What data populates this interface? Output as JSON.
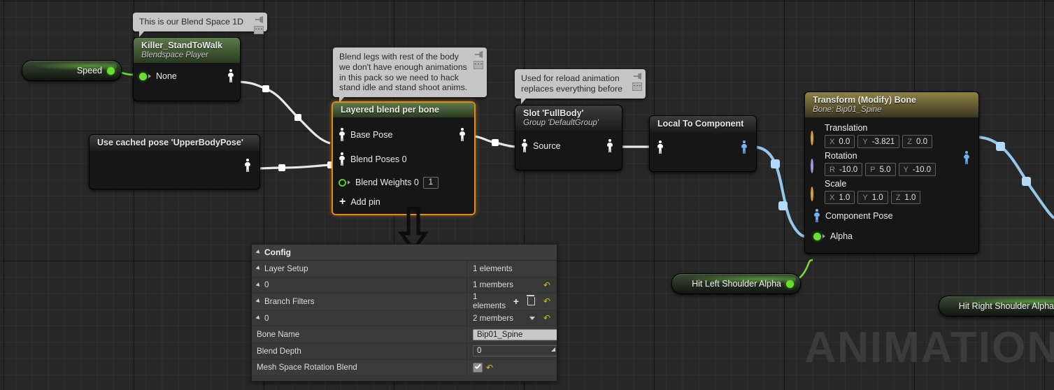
{
  "graph": {
    "watermark": "ANIMATION"
  },
  "comments": [
    {
      "text": "This is our Blend Space 1D",
      "pin_icon": "pin-icon",
      "resize_icon": "comment-bubble-icon"
    },
    {
      "text": "Blend legs with rest of the body we don't have enough animations in this pack so we need to hack stand idle and stand shoot anims.",
      "pin_icon": "pin-icon",
      "resize_icon": "comment-bubble-icon"
    },
    {
      "text": "Used for reload animation replaces everything before",
      "pin_icon": "pin-icon",
      "resize_icon": "comment-bubble-icon"
    }
  ],
  "variables": {
    "speed": "Speed",
    "hit_left_shoulder_alpha": "Hit Left Shoulder Alpha",
    "hit_right_shoulder_alpha": "Hit Right Shoulder Alpha"
  },
  "nodes": {
    "blendspace": {
      "title": "Killer_StandToWalk",
      "subtitle": "Blendspace Player",
      "input_pin": "None"
    },
    "cached_pose": {
      "title": "Use cached pose 'UpperBodyPose'"
    },
    "layered_blend": {
      "title": "Layered blend per bone",
      "pins": [
        "Base Pose",
        "Blend Poses 0",
        "Blend Weights 0"
      ],
      "blend_weight_value": "1",
      "add_pin": "Add pin"
    },
    "slot": {
      "title": "Slot 'FullBody'",
      "subtitle": "Group 'DefaultGroup'",
      "input_pin": "Source"
    },
    "local_to_component": {
      "title": "Local To Component"
    },
    "transform_bone": {
      "title": "Transform (Modify) Bone",
      "subtitle": "Bone: Bip01_Spine",
      "translation": {
        "label": "Translation",
        "x_axis": "X",
        "x": "0.0",
        "y_axis": "Y",
        "y": "-3.821",
        "z_axis": "Z",
        "z": "0.0"
      },
      "rotation": {
        "label": "Rotation",
        "r_axis": "R",
        "r": "-10.0",
        "p_axis": "P",
        "p": "5.0",
        "y_axis": "Y",
        "y": "-10.0"
      },
      "scale": {
        "label": "Scale",
        "x_axis": "X",
        "x": "1.0",
        "y_axis": "Y",
        "y": "1.0",
        "z_axis": "Z",
        "z": "1.0"
      },
      "component_pose": "Component Pose",
      "alpha": "Alpha"
    }
  },
  "config": {
    "header": "Config",
    "rows": [
      {
        "name": "Layer Setup",
        "value": "1 elements",
        "indent": 1,
        "expander": "expanded",
        "reset": false,
        "add": false,
        "del": false,
        "field": "none"
      },
      {
        "name": "0",
        "value": "1 members",
        "indent": 2,
        "expander": "expanded",
        "reset": true,
        "add": false,
        "del": false,
        "field": "none"
      },
      {
        "name": "Branch Filters",
        "value": "1 elements",
        "indent": 3,
        "expander": "expanded",
        "reset": true,
        "add": true,
        "del": true,
        "field": "none"
      },
      {
        "name": "0",
        "value": "2 members",
        "indent": 4,
        "expander": "expanded",
        "reset": true,
        "add": false,
        "del": false,
        "field": "dropdown"
      },
      {
        "name": "Bone Name",
        "value": "Bip01_Spine",
        "indent": 5,
        "expander": "none",
        "reset": true,
        "add": false,
        "del": false,
        "field": "text"
      },
      {
        "name": "Blend Depth",
        "value": "0",
        "indent": 5,
        "expander": "none",
        "reset": true,
        "add": false,
        "del": false,
        "field": "number"
      },
      {
        "name": "Mesh Space Rotation Blend",
        "value": "",
        "indent": 2,
        "expander": "none",
        "reset": true,
        "add": false,
        "del": false,
        "field": "checkbox"
      }
    ]
  }
}
